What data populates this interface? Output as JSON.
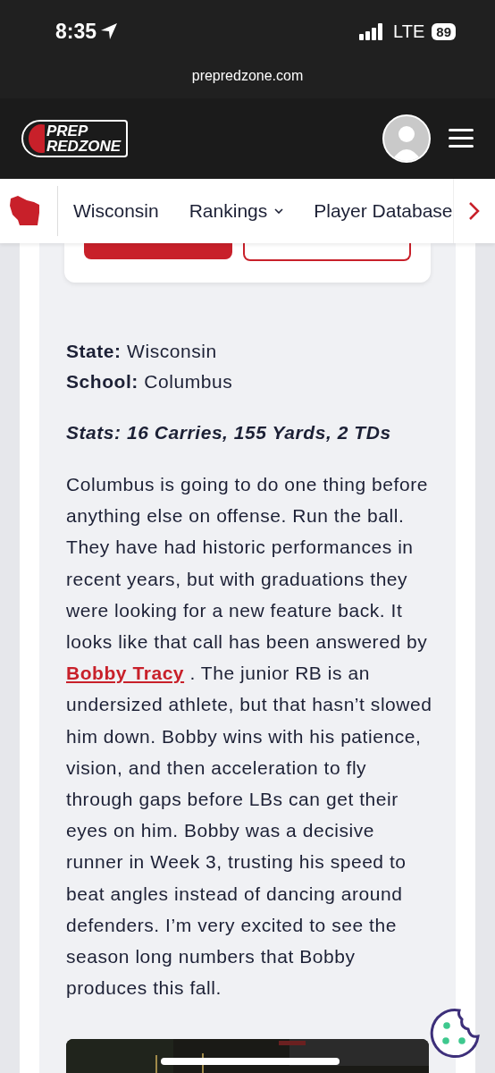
{
  "status_bar": {
    "time": "8:35",
    "network": "LTE",
    "battery": "89"
  },
  "browser": {
    "url": "prepredzone.com"
  },
  "header": {
    "logo_line_1": "PREP",
    "logo_line_2": "REDZONE"
  },
  "state_nav": {
    "items": [
      {
        "label": "Wisconsin",
        "has_dropdown": false
      },
      {
        "label": "Rankings",
        "has_dropdown": true
      },
      {
        "label": "Player Database",
        "has_dropdown": false
      }
    ]
  },
  "article": {
    "facts": [
      {
        "label": "State:",
        "value": "Wisconsin"
      },
      {
        "label": "School:",
        "value": "Columbus"
      }
    ],
    "stats": "Stats: 16 Carries, 155 Yards, 2 TDs",
    "paragraph_before_link": "Columbus is going to do one thing before anything else on offense. Run the ball. They have had historic performances in recent years, but with graduations they were looking for a new feature back. It looks like that call has been answered by",
    "link": "Bobby Tracy",
    "paragraph_after_link": ". The junior RB is an undersized athlete, but that hasn’t slowed him down. Bobby wins with his patience, vision, and then acceleration to fly through gaps before LBs can get their eyes on him. Bobby was a decisive runner in Week 3, trusting his speed to beat angles instead of dancing around defenders. I’m very excited to see the season long numbers that Bobby produces this fall."
  }
}
